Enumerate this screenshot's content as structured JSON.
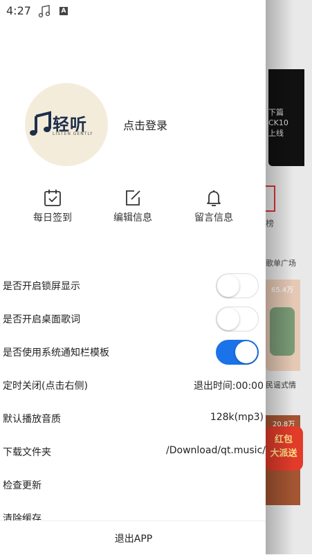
{
  "status_bar": {
    "time": "4:27",
    "icon1": "music-note-icon",
    "icon2": "a-icon",
    "icon2_glyph": "A"
  },
  "profile": {
    "logo_text": "轻听",
    "logo_subtext": "LISTEN GENTLY",
    "login_label": "点击登录",
    "logo_bg": "#f4ecda",
    "logo_color": "#1e2f4c"
  },
  "quick_actions": [
    {
      "label": "每日签到",
      "icon": "calendar-check-icon"
    },
    {
      "label": "编辑信息",
      "icon": "edit-icon"
    },
    {
      "label": "留言信息",
      "icon": "bell-icon"
    }
  ],
  "settings": {
    "lockscreen": {
      "label": "是否开启锁屏显示",
      "on": false
    },
    "desktop_lyrics": {
      "label": "是否开启桌面歌词",
      "on": false
    },
    "notification": {
      "label": "是否使用系统通知栏模板",
      "on": true
    },
    "timer": {
      "label": "定时关闭(点击右侧)",
      "value": "退出时间:00:00"
    },
    "quality": {
      "label": "默认播放音质",
      "value": "128k(mp3)"
    },
    "download": {
      "label": "下载文件夹",
      "value": "/Download/qt.music/"
    },
    "update": {
      "label": "检查更新"
    },
    "clear_cache": {
      "label": "清除缓存"
    }
  },
  "logout": {
    "label": "退出APP"
  },
  "background_app": {
    "banner_lines": [
      "下篇",
      "CK10",
      "上线"
    ],
    "rank_label": "榜",
    "playlist_label": "歌单广场",
    "card1_count": "65.4万",
    "card1_label": "民谣式情",
    "card2_count": "20.8万",
    "red_packet": [
      "红包",
      "大派送"
    ]
  },
  "colors": {
    "accent": "#1a73e8",
    "red": "#e23b2a"
  }
}
